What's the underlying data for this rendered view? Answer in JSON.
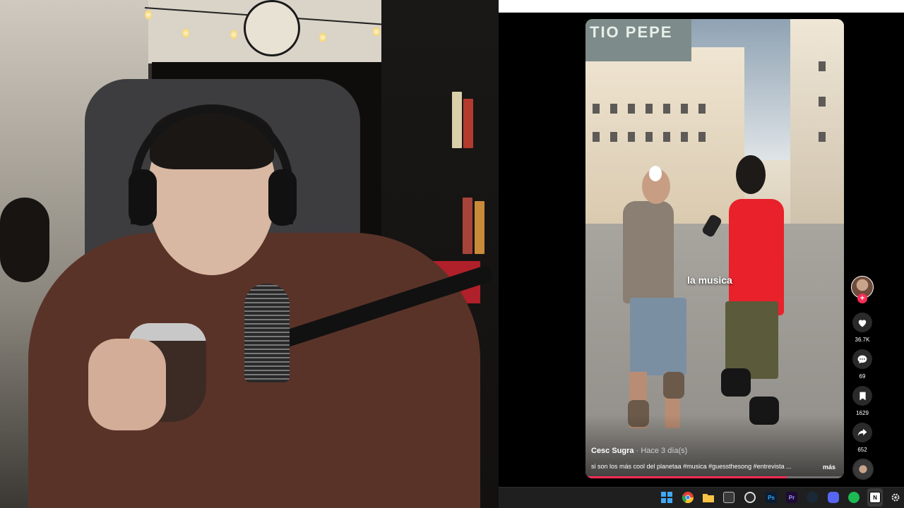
{
  "webcam": {
    "description_icon": "webcam-feed"
  },
  "video": {
    "overlay_text": "la musica",
    "sign_text": "TIO PEPE",
    "author": "Cesc Sugra",
    "separator": " · ",
    "posted": "Hace 3 día(s)",
    "description": "si son los más cool del planetaa #musica #guessthesong #entrevista ...",
    "more_label": "más",
    "progress_fraction": 0.78
  },
  "actions": {
    "follow_symbol": "+",
    "likes": "36.7K",
    "comments": "69",
    "saves": "1629",
    "shares": "652"
  },
  "colors": {
    "accent": "#fe2c55",
    "taskbar": "#1f1f1f"
  },
  "taskbar": {
    "icons": [
      "windows-icon",
      "chrome-icon",
      "file-explorer-icon",
      "snipping-tool-icon",
      "obs-icon",
      "photoshop-icon",
      "premiere-icon",
      "steam-icon",
      "discord-icon",
      "spotify-icon",
      "notion-icon",
      "settings-icon"
    ],
    "photoshop_label": "Ps",
    "premiere_label": "Pr",
    "notion_label": "N"
  }
}
